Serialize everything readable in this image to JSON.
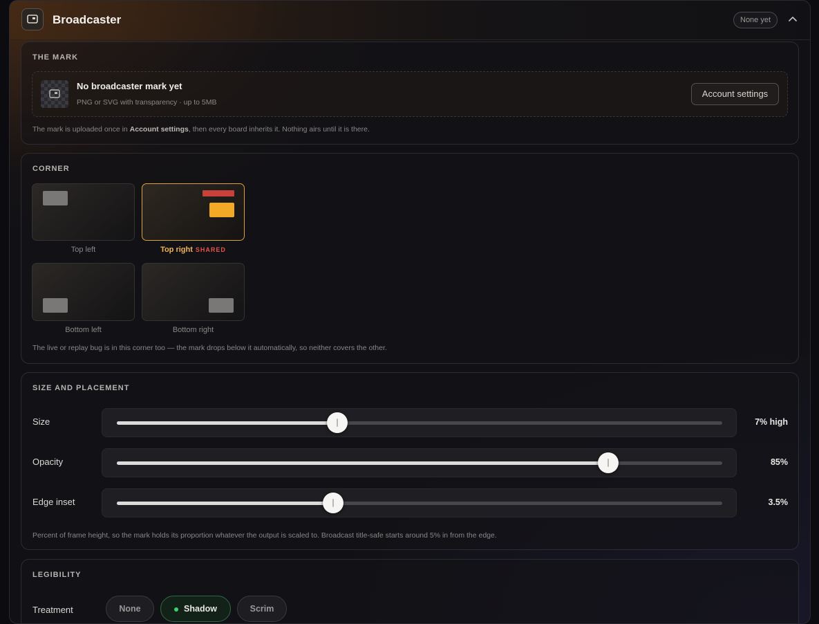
{
  "header": {
    "title": "Broadcaster",
    "badge": "None yet"
  },
  "mark": {
    "section_title": "THE MARK",
    "title": "No broadcaster mark yet",
    "subtitle": "PNG or SVG with transparency · up to 5MB",
    "button": "Account settings",
    "note_pre": "The mark is uploaded once in ",
    "note_bold": "Account settings",
    "note_post": ", then every board inherits it. Nothing airs until it is there."
  },
  "corner": {
    "section_title": "CORNER",
    "options": [
      {
        "label": "Top left",
        "selected": false
      },
      {
        "label": "Top right",
        "selected": true,
        "tag": "SHARED"
      },
      {
        "label": "Bottom left",
        "selected": false
      },
      {
        "label": "Bottom right",
        "selected": false
      }
    ],
    "note": "The live or replay bug is in this corner too — the mark drops below it automatically, so neither covers the other."
  },
  "size": {
    "section_title": "SIZE AND PLACEMENT",
    "sliders": [
      {
        "label": "Size",
        "value_text": "7% high",
        "fraction": 0.364
      },
      {
        "label": "Opacity",
        "value_text": "85%",
        "fraction": 0.812
      },
      {
        "label": "Edge inset",
        "value_text": "3.5%",
        "fraction": 0.357
      }
    ],
    "note": "Percent of frame height, so the mark holds its proportion whatever the output is scaled to. Broadcast title-safe starts around 5% in from the edge."
  },
  "legibility": {
    "section_title": "LEGIBILITY",
    "treatment_label": "Treatment",
    "options": [
      {
        "label": "None",
        "selected": false
      },
      {
        "label": "Shadow",
        "selected": true
      },
      {
        "label": "Scrim",
        "selected": false
      }
    ]
  },
  "colors": {
    "accent": "#e0a03a",
    "mark_fill": "#f3a826",
    "shared": "#e2554b",
    "active": "#3ad16e"
  }
}
